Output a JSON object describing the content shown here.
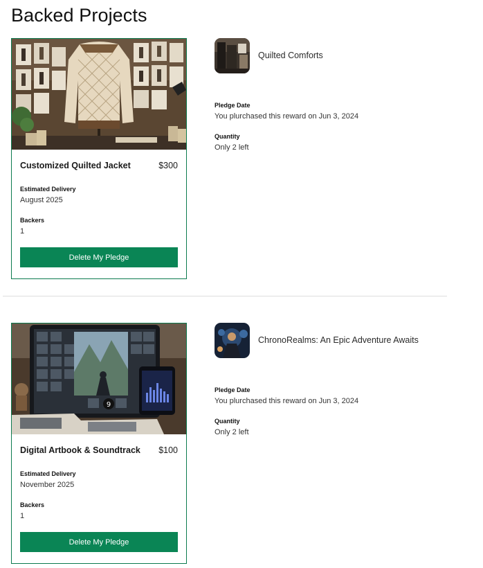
{
  "page": {
    "title": "Backed Projects"
  },
  "projects": [
    {
      "reward_title": "Customized Quilted Jacket",
      "reward_price": "$300",
      "delivery_label": "Estimated Delivery",
      "delivery_value": "August 2025",
      "backers_label": "Backers",
      "backers_value": "1",
      "button_label": "Delete My Pledge",
      "project_name": "Quilted Comforts",
      "pledge_date_label": "Pledge Date",
      "pledge_date_value": "You plurchased this reward on Jun 3, 2024",
      "quantity_label": "Quantity",
      "quantity_value": "Only 2 left"
    },
    {
      "reward_title": "Digital Artbook & Soundtrack",
      "reward_price": "$100",
      "delivery_label": "Estimated Delivery",
      "delivery_value": "November 2025",
      "backers_label": "Backers",
      "backers_value": "1",
      "button_label": "Delete My Pledge",
      "project_name": "ChronoRealms: An Epic Adventure Awaits",
      "pledge_date_label": "Pledge Date",
      "pledge_date_value": "You plurchased this reward on Jun 3, 2024",
      "quantity_label": "Quantity",
      "quantity_value": "Only 2 left"
    }
  ],
  "theme": {
    "accent": "#0a8555",
    "card_border": "#0a7a4e"
  }
}
